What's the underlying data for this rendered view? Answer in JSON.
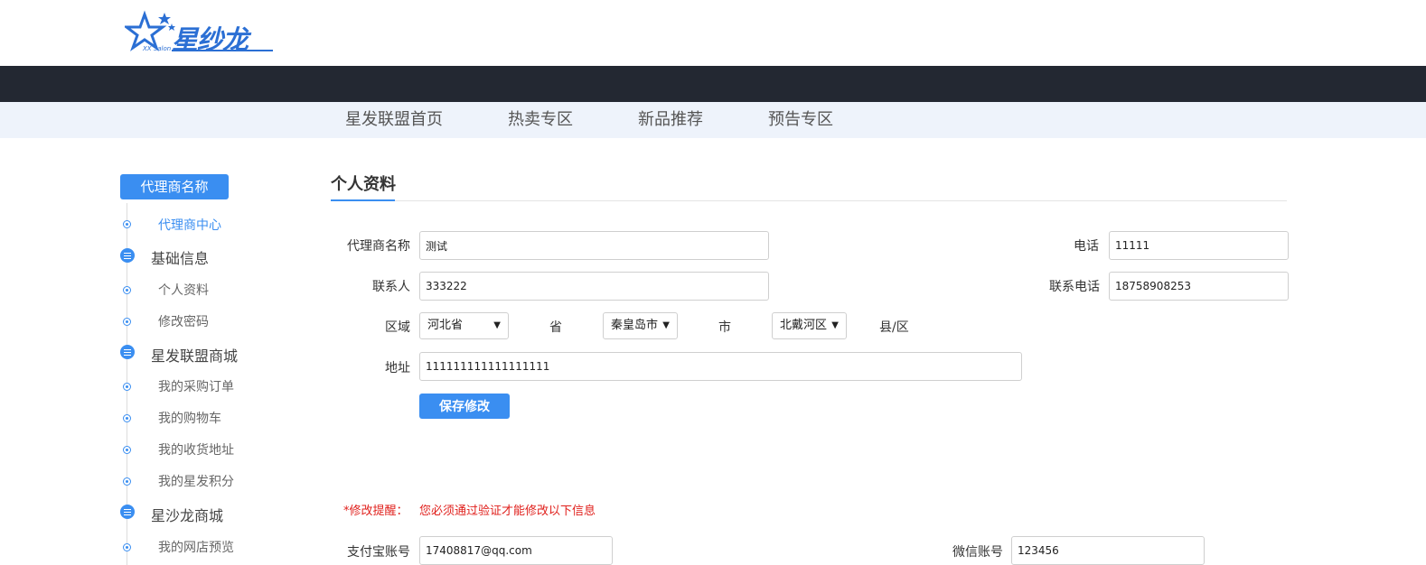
{
  "logo": {
    "text": "星纱龙",
    "sub": "XX Salon"
  },
  "nav": [
    "星发联盟首页",
    "热卖专区",
    "新品推荐",
    "预告专区"
  ],
  "sidebar": {
    "title": "代理商名称",
    "active_item": "代理商中心",
    "sections": [
      {
        "label": "基础信息",
        "items": [
          "个人资料",
          "修改密码"
        ]
      },
      {
        "label": "星发联盟商城",
        "items": [
          "我的采购订单",
          "我的购物车",
          "我的收货地址",
          "我的星发积分"
        ]
      },
      {
        "label": "星沙龙商城",
        "items": [
          "我的网店预览"
        ]
      }
    ]
  },
  "form": {
    "title": "个人资料",
    "agent_name": {
      "label": "代理商名称",
      "value": "测试"
    },
    "phone": {
      "label": "电话",
      "value": "11111"
    },
    "contact": {
      "label": "联系人",
      "value": "333222"
    },
    "contact_phone": {
      "label": "联系电话",
      "value": "18758908253"
    },
    "region": {
      "label": "区域",
      "province": "河北省",
      "province_unit": "省",
      "city": "秦皇岛市",
      "city_unit": "市",
      "county": "北戴河区",
      "county_unit": "县/区"
    },
    "address": {
      "label": "地址",
      "value": "111111111111111111"
    },
    "save_label": "保存修改"
  },
  "reminder": {
    "label": "*修改提醒：",
    "text": "您必须通过验证才能修改以下信息"
  },
  "extra": {
    "alipay": {
      "label": "支付宝账号",
      "value": "17408817@qq.com"
    },
    "wechat": {
      "label": "微信账号",
      "value": "123456"
    }
  },
  "colors": {
    "accent": "#3a8ef1",
    "dark_bar": "#232832",
    "nav_bg": "#eef3fb",
    "warning": "#e0201c"
  }
}
